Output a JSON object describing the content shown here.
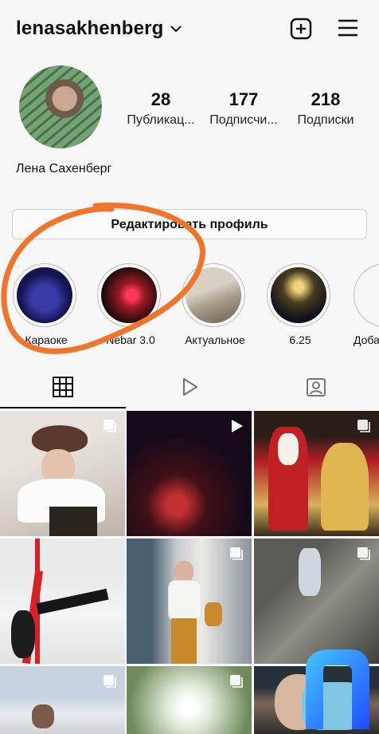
{
  "header": {
    "username": "lenasakhenberg",
    "icons": [
      "chevron-down-icon",
      "new-post-icon",
      "menu-icon"
    ]
  },
  "profile": {
    "full_name": "Лена Сахенберг",
    "stats": [
      {
        "value": "28",
        "label": "Публикац..."
      },
      {
        "value": "177",
        "label": "Подписчи..."
      },
      {
        "value": "218",
        "label": "Подписки"
      }
    ],
    "edit_button": "Редактировать профиль"
  },
  "highlights": [
    {
      "label": "Караоке"
    },
    {
      "label": "Nebar 3.0"
    },
    {
      "label": "Актуальное"
    },
    {
      "label": "6.25"
    },
    {
      "label": "Доба"
    }
  ],
  "tabs": [
    {
      "name": "grid",
      "icon": "grid-icon",
      "active": true
    },
    {
      "name": "reels",
      "icon": "reels-play-icon",
      "active": false
    },
    {
      "name": "tagged",
      "icon": "tagged-person-icon",
      "active": false
    }
  ],
  "posts": [
    {
      "type": "multi"
    },
    {
      "type": "video"
    },
    {
      "type": "multi"
    },
    {
      "type": "none"
    },
    {
      "type": "multi"
    },
    {
      "type": "multi"
    },
    {
      "type": "multi"
    },
    {
      "type": "multi"
    },
    {
      "type": "none"
    }
  ],
  "colors": {
    "annotation": "#f0752b",
    "background": "#f7f7f7",
    "text": "#111111"
  }
}
